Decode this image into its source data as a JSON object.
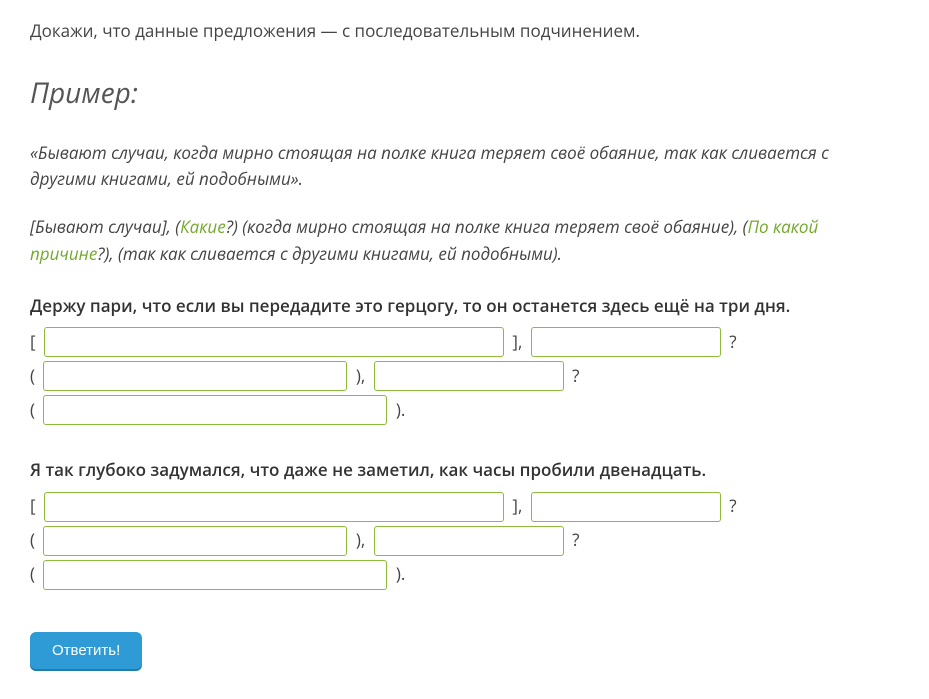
{
  "instruction": "Докажи, что данные предложения — с последовательным подчинением.",
  "example_heading": "Пример:",
  "example_quote": "«Бывают случаи, когда мирно стоящая на полке книга теряет своё обаяние, так как сливается с другими книгами, ей подобными».",
  "schema": {
    "p1": "[Бывают случаи], (",
    "g1": "Какие",
    "p2": "?) (когда мирно стоящая на полке книга теряет своё обаяние), (",
    "g2": "По какой причине",
    "p3": "?), (так как сливается с другими книгами, ей подобными)."
  },
  "tasks": [
    {
      "sentence": "Держу пари, что если вы передадите это герцогу, то он останется здесь ещё на три дня.",
      "parts": {
        "l1a": "[ ",
        "l1b": " ], ",
        "l1c": " ?",
        "l2a": "( ",
        "l2b": " ), ",
        "l2c": " ?",
        "l3a": "( ",
        "l3b": " )."
      }
    },
    {
      "sentence": "Я так глубоко задумался, что даже не заметил, как часы пробили двенадцать.",
      "parts": {
        "l1a": "[ ",
        "l1b": " ], ",
        "l1c": " ?",
        "l2a": "( ",
        "l2b": " ), ",
        "l2c": " ?",
        "l3a": "( ",
        "l3b": " )."
      }
    }
  ],
  "answer_button": "Ответить!"
}
